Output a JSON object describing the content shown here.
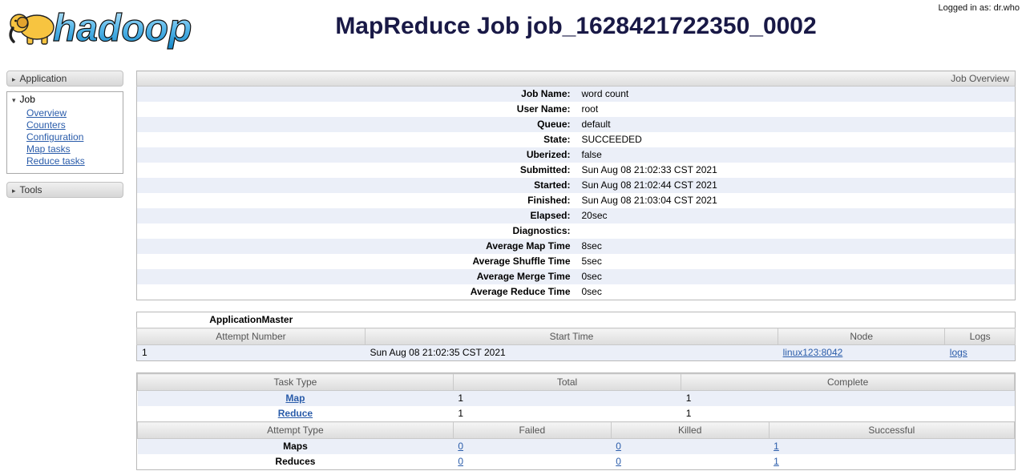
{
  "header": {
    "logo_text": "hadoop",
    "title": "MapReduce Job job_1628421722350_0002",
    "logged_in_label": "Logged in as: dr.who"
  },
  "colors": {
    "row_stripe": "#ebeff8",
    "header_gray": "#dcdcdc",
    "link_blue": "#2a5caa",
    "title_navy": "#191946",
    "logo_yellow": "#f7c440",
    "logo_blue": "#56b7ea"
  },
  "sidebar": {
    "application_label": "Application",
    "job_label": "Job",
    "tools_label": "Tools",
    "job_links": [
      "Overview",
      "Counters",
      "Configuration",
      "Map tasks",
      "Reduce tasks"
    ]
  },
  "overview": {
    "caption": "Job Overview",
    "rows": [
      {
        "label": "Job Name:",
        "value": "word count"
      },
      {
        "label": "User Name:",
        "value": "root"
      },
      {
        "label": "Queue:",
        "value": "default"
      },
      {
        "label": "State:",
        "value": "SUCCEEDED"
      },
      {
        "label": "Uberized:",
        "value": "false"
      },
      {
        "label": "Submitted:",
        "value": "Sun Aug 08 21:02:33 CST 2021"
      },
      {
        "label": "Started:",
        "value": "Sun Aug 08 21:02:44 CST 2021"
      },
      {
        "label": "Finished:",
        "value": "Sun Aug 08 21:03:04 CST 2021"
      },
      {
        "label": "Elapsed:",
        "value": "20sec"
      },
      {
        "label": "Diagnostics:",
        "value": ""
      },
      {
        "label": "Average Map Time",
        "value": "8sec"
      },
      {
        "label": "Average Shuffle Time",
        "value": "5sec"
      },
      {
        "label": "Average Merge Time",
        "value": "0sec"
      },
      {
        "label": "Average Reduce Time",
        "value": "0sec"
      }
    ]
  },
  "app_master": {
    "title": "ApplicationMaster",
    "columns": [
      "Attempt Number",
      "Start Time",
      "Node",
      "Logs"
    ],
    "row": {
      "attempt": "1",
      "start_time": "Sun Aug 08 21:02:35 CST 2021",
      "node": "linux123:8042",
      "logs": "logs"
    }
  },
  "tasks": {
    "columns": [
      "Task Type",
      "Total",
      "Complete"
    ],
    "rows": [
      {
        "type": "Map",
        "total": "1",
        "complete": "1"
      },
      {
        "type": "Reduce",
        "total": "1",
        "complete": "1"
      }
    ],
    "attempt": {
      "columns": [
        "Attempt Type",
        "Failed",
        "Killed",
        "Successful"
      ],
      "rows": [
        {
          "type": "Maps",
          "failed": "0",
          "killed": "0",
          "successful": "1"
        },
        {
          "type": "Reduces",
          "failed": "0",
          "killed": "0",
          "successful": "1"
        }
      ]
    }
  }
}
